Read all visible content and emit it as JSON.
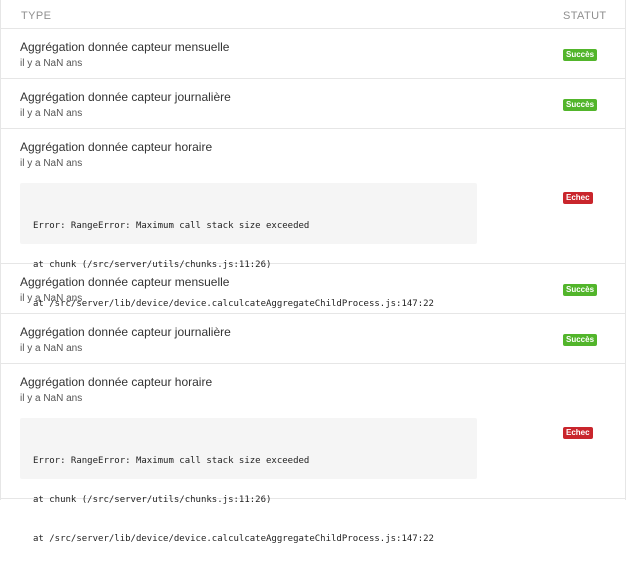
{
  "table": {
    "headers": {
      "type": "TYPE",
      "status": "STATUT"
    },
    "rows": [
      {
        "title": "Aggrégation donnée capteur mensuelle",
        "time": "il y a NaN ans",
        "status": "Succès",
        "kind": "ok"
      },
      {
        "title": "Aggrégation donnée capteur journalière",
        "time": "il y a NaN ans",
        "status": "Succès",
        "kind": "ok"
      },
      {
        "title": "Aggrégation donnée capteur horaire",
        "time": "il y a NaN ans",
        "status": "Echec",
        "kind": "err",
        "error": [
          "Error: RangeError: Maximum call stack size exceeded",
          "at chunk (/src/server/utils/chunks.js:11:26)",
          "at /src/server/lib/device/device.calculcateAggregateChildProcess.js:147:22"
        ]
      },
      {
        "title": "Aggrégation donnée capteur mensuelle",
        "time": "il y a NaN ans",
        "status": "Succès",
        "kind": "ok"
      },
      {
        "title": "Aggrégation donnée capteur journalière",
        "time": "il y a NaN ans",
        "status": "Succès",
        "kind": "ok"
      },
      {
        "title": "Aggrégation donnée capteur horaire",
        "time": "il y a NaN ans",
        "status": "Echec",
        "kind": "err",
        "error": [
          "Error: RangeError: Maximum call stack size exceeded",
          "at chunk (/src/server/utils/chunks.js:11:26)",
          "at /src/server/lib/device/device.calculcateAggregateChildProcess.js:147:22"
        ]
      }
    ]
  },
  "colors": {
    "success": "#52b52b",
    "failure": "#c9252c"
  }
}
